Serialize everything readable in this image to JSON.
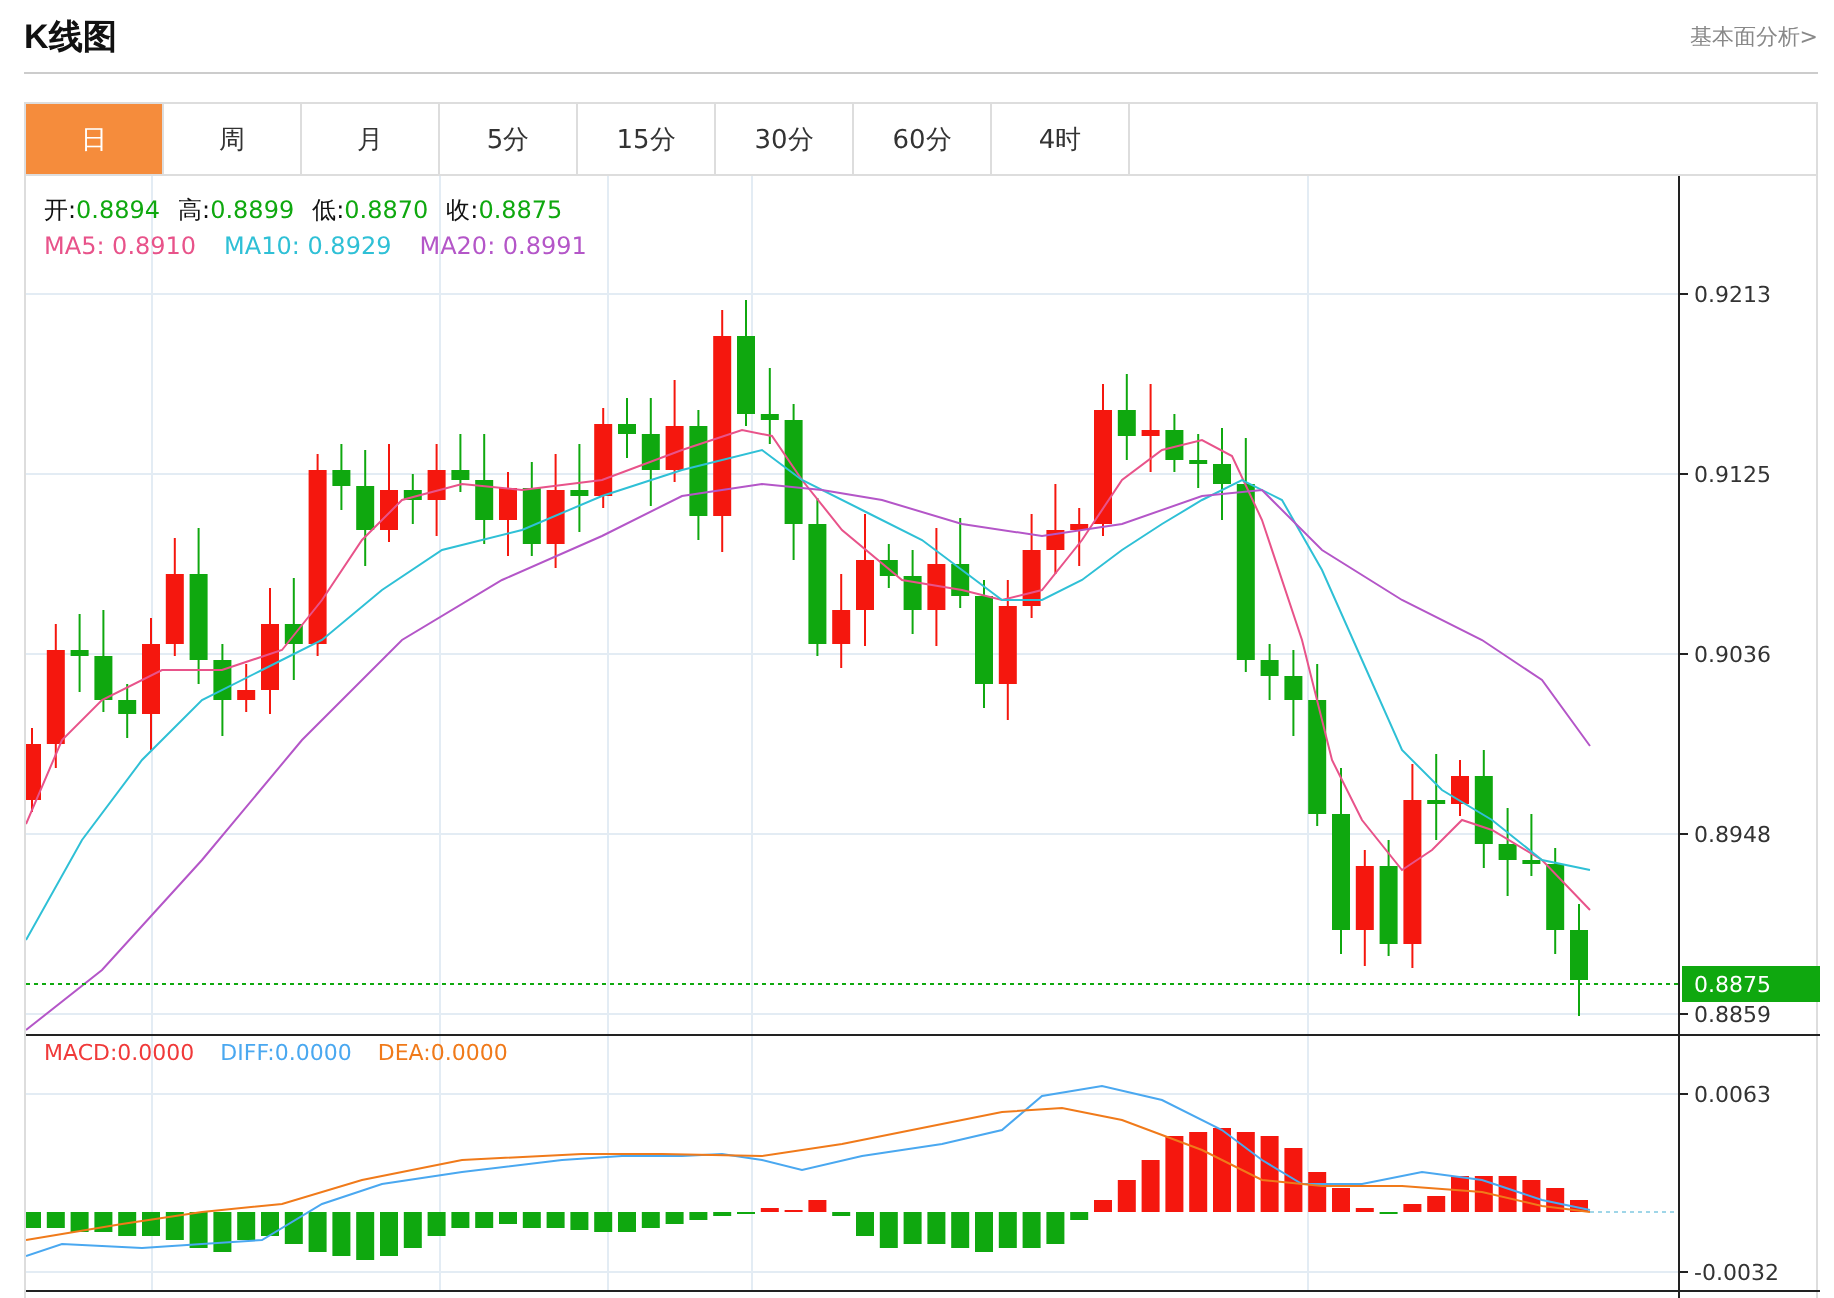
{
  "title": "K线图",
  "analysis_link": "基本面分析>",
  "tabs": [
    {
      "label": "日",
      "selected": true
    },
    {
      "label": "周",
      "selected": false
    },
    {
      "label": "月",
      "selected": false
    },
    {
      "label": "5分",
      "selected": false
    },
    {
      "label": "15分",
      "selected": false
    },
    {
      "label": "30分",
      "selected": false
    },
    {
      "label": "60分",
      "selected": false
    },
    {
      "label": "4时",
      "selected": false
    }
  ],
  "ohlc": [
    {
      "label": "开:",
      "value": "0.8894"
    },
    {
      "label": "高:",
      "value": "0.8899"
    },
    {
      "label": "低:",
      "value": "0.8870"
    },
    {
      "label": "收:",
      "value": "0.8875"
    }
  ],
  "moving_averages": [
    {
      "label": "MA5: 0.8910",
      "color": "#e8538a"
    },
    {
      "label": "MA10: 0.8929",
      "color": "#2fc0d6"
    },
    {
      "label": "MA20: 0.8991",
      "color": "#b456c8"
    }
  ],
  "price_axis": [
    "0.9213",
    "0.9125",
    "0.9036",
    "0.8948",
    "0.8859"
  ],
  "last_price": "0.8875",
  "macd_legend": [
    {
      "label": "MACD:0.0000",
      "color": "#f03a3a"
    },
    {
      "label": "DIFF:0.0000",
      "color": "#4aa8f0"
    },
    {
      "label": "DEA:0.0000",
      "color": "#f07a1a"
    }
  ],
  "macd_axis": [
    "0.0063",
    "-0.0032"
  ]
}
